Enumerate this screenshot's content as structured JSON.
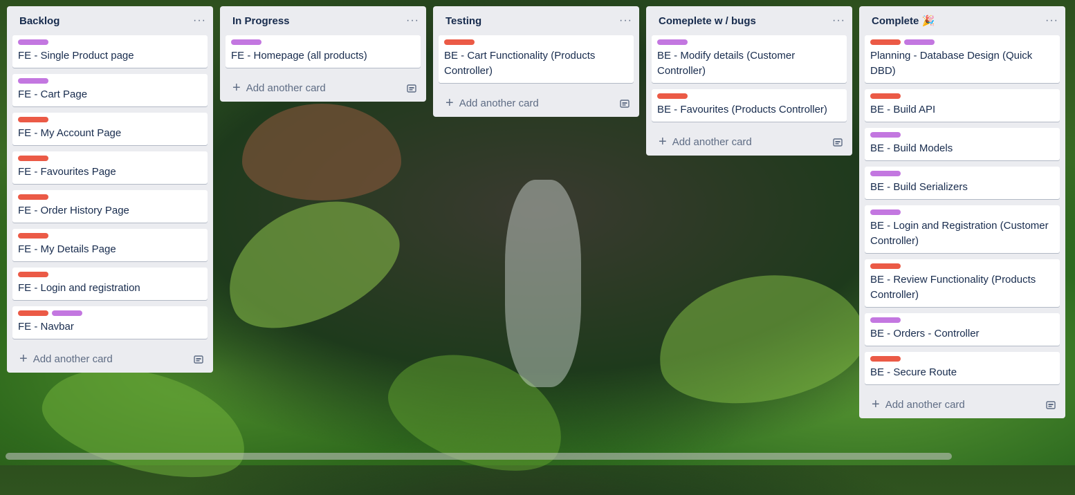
{
  "colors": {
    "purple": "#c377e0",
    "red": "#eb5a46"
  },
  "lists": [
    {
      "title": "Backlog",
      "add_label": "Add another card",
      "cards": [
        {
          "labels": [
            "purple"
          ],
          "title": "FE - Single Product page"
        },
        {
          "labels": [
            "purple"
          ],
          "title": "FE - Cart Page"
        },
        {
          "labels": [
            "red"
          ],
          "title": "FE - My Account Page"
        },
        {
          "labels": [
            "red"
          ],
          "title": "FE - Favourites Page"
        },
        {
          "labels": [
            "red"
          ],
          "title": "FE - Order History Page"
        },
        {
          "labels": [
            "red"
          ],
          "title": "FE - My Details Page"
        },
        {
          "labels": [
            "red"
          ],
          "title": "FE - Login and registration"
        },
        {
          "labels": [
            "red",
            "purple"
          ],
          "title": "FE - Navbar"
        }
      ]
    },
    {
      "title": "In Progress",
      "add_label": "Add another card",
      "cards": [
        {
          "labels": [
            "purple"
          ],
          "title": "FE - Homepage (all products)"
        }
      ]
    },
    {
      "title": "Testing",
      "add_label": "Add another card",
      "cards": [
        {
          "labels": [
            "red"
          ],
          "title": "BE - Cart Functionality (Products Controller)"
        }
      ]
    },
    {
      "title": "Comeplete w / bugs",
      "add_label": "Add another card",
      "cards": [
        {
          "labels": [
            "purple"
          ],
          "title": "BE - Modify details (Customer Controller)"
        },
        {
          "labels": [
            "red"
          ],
          "title": "BE - Favourites (Products Controller)"
        }
      ]
    },
    {
      "title": "Complete 🎉",
      "add_label": "Add another card",
      "cards": [
        {
          "labels": [
            "red",
            "purple"
          ],
          "title": "Planning - Database Design (Quick DBD)"
        },
        {
          "labels": [
            "red"
          ],
          "title": "BE - Build API"
        },
        {
          "labels": [
            "purple"
          ],
          "title": "BE - Build Models"
        },
        {
          "labels": [
            "purple"
          ],
          "title": "BE - Build Serializers"
        },
        {
          "labels": [
            "purple"
          ],
          "title": "BE - Login and Registration (Customer Controller)"
        },
        {
          "labels": [
            "red"
          ],
          "title": "BE - Review Functionality (Products Controller)"
        },
        {
          "labels": [
            "purple"
          ],
          "title": "BE - Orders - Controller"
        },
        {
          "labels": [
            "red"
          ],
          "title": "BE - Secure Route"
        }
      ]
    }
  ],
  "icons": {
    "list_menu": "ellipsis-icon",
    "add": "plus-icon",
    "template": "card-template-icon"
  }
}
